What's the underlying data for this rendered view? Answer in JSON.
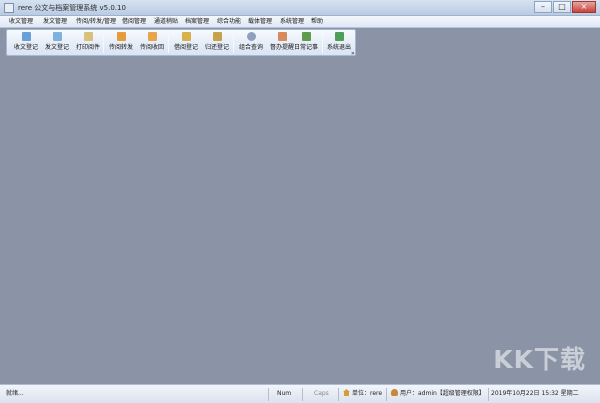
{
  "window": {
    "title": "rere 公文与档案管理系统 v5.0.10"
  },
  "menu": [
    "收文管理",
    "发文管理",
    "传阅/转发/管理",
    "借阅管理",
    "通道稍贴",
    "档案管理",
    "综合功能",
    "载体管理",
    "系统管理",
    "帮助"
  ],
  "toolbar": [
    {
      "label": "收文登记",
      "icon": "document-in-icon",
      "color": "#6aa0d8"
    },
    {
      "label": "发文登记",
      "icon": "document-out-icon",
      "color": "#7fb0e0"
    },
    {
      "label": "打印阅件",
      "icon": "print-icon",
      "color": "#d8c17a"
    },
    {
      "label": "传阅转发",
      "icon": "forward-arrow-icon",
      "color": "#e89b3a"
    },
    {
      "label": "传阅收回",
      "icon": "return-arrow-icon",
      "color": "#e8a64c"
    },
    {
      "label": "借阅登记",
      "icon": "borrow-icon",
      "color": "#d7b24a"
    },
    {
      "label": "归还登记",
      "icon": "return-icon",
      "color": "#c7a24a"
    },
    {
      "label": "组合查询",
      "icon": "search-icon",
      "color": "#8e9fbf"
    },
    {
      "label": "督办提醒",
      "icon": "reminder-icon",
      "color": "#d88a5a"
    },
    {
      "label": "日常记事",
      "icon": "notebook-icon",
      "color": "#5f9c4e"
    },
    {
      "label": "系统退出",
      "icon": "exit-icon",
      "color": "#4f9f5a"
    }
  ],
  "status": {
    "ready": "就绪...",
    "num": "Num",
    "caps": "Caps",
    "unit": "单位：rere",
    "user": "用户：admin【超级管理权限】",
    "datetime": "2019年10月22日 15:32 星期二"
  },
  "watermark": "KK下载",
  "colors": {
    "workspace": "#8a94a6",
    "toolbar_bg": "#dfe8f5",
    "title_bg": "#c8d7eb"
  }
}
